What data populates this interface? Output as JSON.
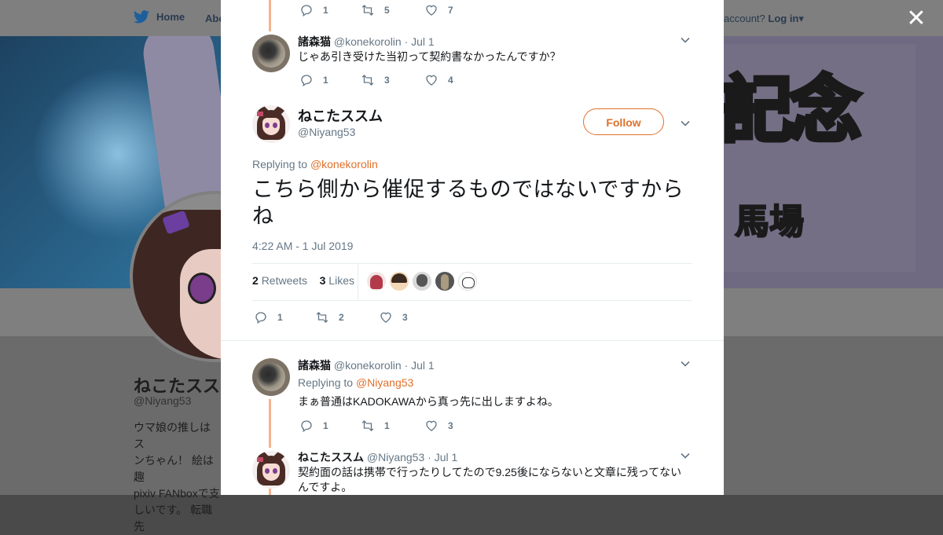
{
  "nav": {
    "home": "Home",
    "about": "Abo",
    "account_prefix": "account?",
    "login": "Log in"
  },
  "banner": {
    "kanji": "記念",
    "sub": "馬場"
  },
  "profile": {
    "name": "ねこたスス",
    "handle": "@Niyang53",
    "bio_lines": [
      "ウマ娘の推しはス",
      "ンちゃん！ 絵は趣",
      "pixiv FANboxで支",
      "しいです。 転職先"
    ]
  },
  "tweets": [
    {
      "id": "top",
      "replies": "1",
      "retweets": "5",
      "likes": "7"
    },
    {
      "id": "kone1",
      "name": "諸森猫",
      "handle": "@konekorolin",
      "date": "· Jul 1",
      "text": "じゃあ引き受けた当初って契約書なかったんですか？",
      "replies": "1",
      "retweets": "3",
      "likes": "4"
    }
  ],
  "main": {
    "name": "ねこたススム",
    "handle": "@Niyang53",
    "follow": "Follow",
    "replying_label": "Replying to",
    "replying_to": "@konekorolin",
    "text": "こちら側から催促するものではないですからね",
    "time": "4:22 AM - 1 Jul 2019",
    "retweets_count": "2",
    "retweets_label": "Retweets",
    "likes_count": "3",
    "likes_label": "Likes",
    "replies": "1",
    "retweets": "2",
    "likes": "3"
  },
  "replies": [
    {
      "name": "諸森猫",
      "handle": "@konekorolin",
      "date": "· Jul 1",
      "replying_label": "Replying to",
      "replying_to": "@Niyang53",
      "text": "まぁ普通はKADOKAWAから真っ先に出しますよね。",
      "replies": "1",
      "retweets": "1",
      "likes": "3"
    },
    {
      "name": "ねこたススム",
      "handle": "@Niyang53",
      "date": "· Jul 1",
      "text_line1": "契約面の話は携帯で行ったりしてたので9.25後にならないと文章に残ってない",
      "text_line2": "んですよ。"
    }
  ],
  "colors": {
    "accent": "#e0702a",
    "thread": "#f5b38f",
    "muted": "#657786",
    "text": "#14171a"
  }
}
